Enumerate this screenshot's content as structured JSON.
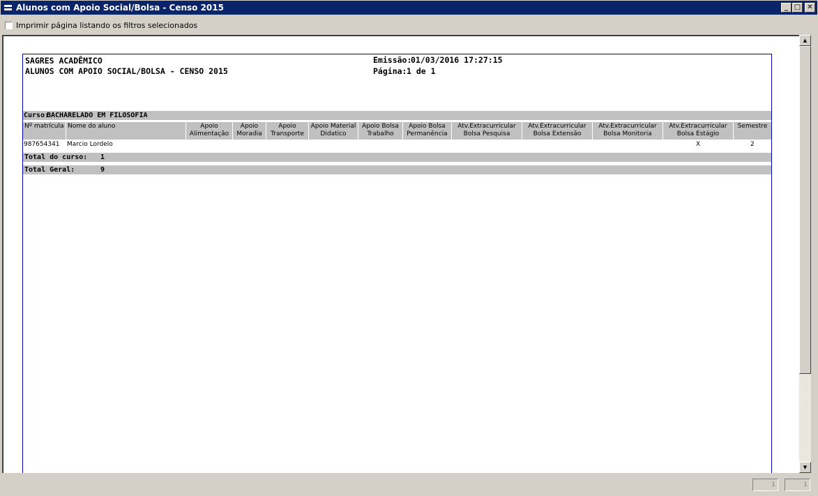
{
  "window": {
    "title": "Alunos com Apoio Social/Bolsa - Censo 2015",
    "minimize": "_",
    "maximize": "□",
    "close": "✕"
  },
  "options": {
    "print_filters_label": "Imprimir página listando os filtros selecionados"
  },
  "report": {
    "system_name": "SAGRES ACADÊMICO",
    "report_title": "ALUNOS COM APOIO SOCIAL/BOLSA - CENSO  2015",
    "emission_label": "Emissão:",
    "emission_value": "01/03/2016 17:27:15",
    "page_label": "Página:",
    "page_value": "1 de 1",
    "course_label": "Curso:",
    "course_name": "BACHARELADO EM FILOSOFIA",
    "columns": [
      "Nº matrícula",
      "Nome do aluno",
      "Apoio Alimentação",
      "Apoio Moradia",
      "Apoio Transporte",
      "Apoio Material Didatico",
      "Apoio Bolsa Trabalho",
      "Apoio Bolsa Permanência",
      "Atv.Extracurricular Bolsa Pesquisa",
      "Atv.Extracurricular Bolsa Extensão",
      "Atv.Extracurricular Bolsa Monitoria",
      "Atv.Extracurricular Bolsa Estágio",
      "Semestre"
    ],
    "row": {
      "matricula": "987654341",
      "nome": "Marcio Lordelo",
      "bolsa_estagio": "X",
      "semestre": "2"
    },
    "total_course_label": "Total do curso:",
    "total_course_value": "1",
    "total_general_label": "Total Geral:",
    "total_general_value": "9"
  },
  "status": {
    "box1": "1",
    "box2": "1"
  }
}
